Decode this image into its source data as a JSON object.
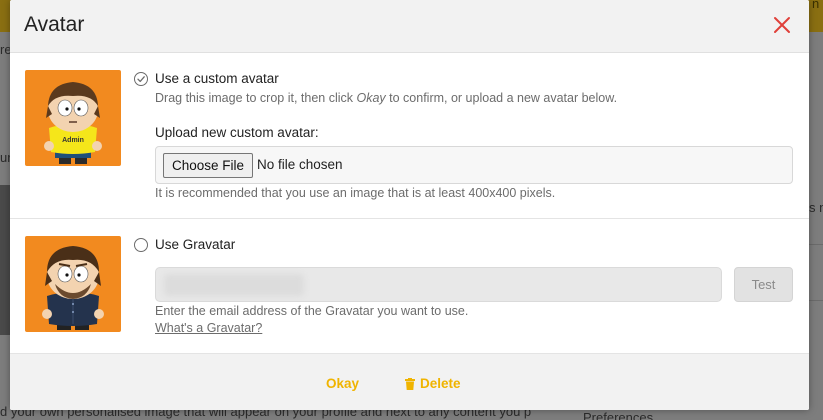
{
  "background": {
    "topbar_fragment": "n",
    "left_fragments": [
      "re",
      "ur"
    ],
    "right_fragment": "s n",
    "bottom_text": "d your own personalised image that will appear on your profile and next to any content you p",
    "bottom_right": "Preferences"
  },
  "modal": {
    "title": "Avatar",
    "custom": {
      "option_label": "Use a custom avatar",
      "hint_before": "Drag this image to crop it, then click ",
      "hint_emphasis": "Okay",
      "hint_after": " to confirm, or upload a new avatar below.",
      "upload_label": "Upload new custom avatar:",
      "choose_button": "Choose File",
      "no_file_text": "No file chosen",
      "recommend_text": "It is recommended that you use an image that is at least 400x400 pixels.",
      "badge_text": "Admin",
      "selected": true
    },
    "gravatar": {
      "option_label": "Use Gravatar",
      "email_value": "",
      "test_button": "Test",
      "email_hint": "Enter the email address of the Gravatar you want to use.",
      "link_text": "What's a Gravatar?",
      "selected": false
    },
    "footer": {
      "okay_label": "Okay",
      "delete_label": "Delete"
    }
  },
  "colors": {
    "accent": "#f0b400",
    "close": "#e0403a",
    "avatar_bg": "#f28a1f"
  },
  "icons": [
    "close-icon",
    "check-circle-icon",
    "radio-empty-icon",
    "trash-icon"
  ]
}
